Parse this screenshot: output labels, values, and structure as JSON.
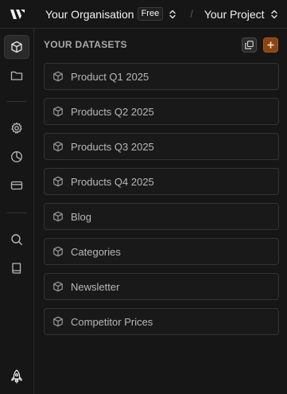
{
  "topbar": {
    "logo_icon": "wedge-logo-icon",
    "organisation": "Your Organisation",
    "plan": "Free",
    "separator": "/",
    "project": "Your Project"
  },
  "rail": {
    "items": [
      {
        "icon": "cube-icon",
        "active": true
      },
      {
        "icon": "folder-icon",
        "active": false
      },
      {
        "icon": "gear-icon",
        "active": false
      },
      {
        "icon": "pie-chart-icon",
        "active": false
      },
      {
        "icon": "credit-card-icon",
        "active": false
      },
      {
        "icon": "search-icon",
        "active": false
      },
      {
        "icon": "book-icon",
        "active": false
      },
      {
        "icon": "rocket-icon",
        "active": false
      }
    ]
  },
  "main": {
    "section_title": "YOUR DATASETS",
    "copy_icon": "copy-icon",
    "add_icon": "plus-icon",
    "datasets": [
      {
        "label": "Product Q1 2025"
      },
      {
        "label": "Products Q2 2025"
      },
      {
        "label": "Products Q3 2025"
      },
      {
        "label": "Products Q4 2025"
      },
      {
        "label": "Blog"
      },
      {
        "label": "Categories"
      },
      {
        "label": "Newsletter"
      },
      {
        "label": "Competitor Prices"
      }
    ]
  },
  "colors": {
    "background": "#161616",
    "accent": "#8a4513",
    "border": "#333333",
    "text": "#b8b8b8"
  }
}
